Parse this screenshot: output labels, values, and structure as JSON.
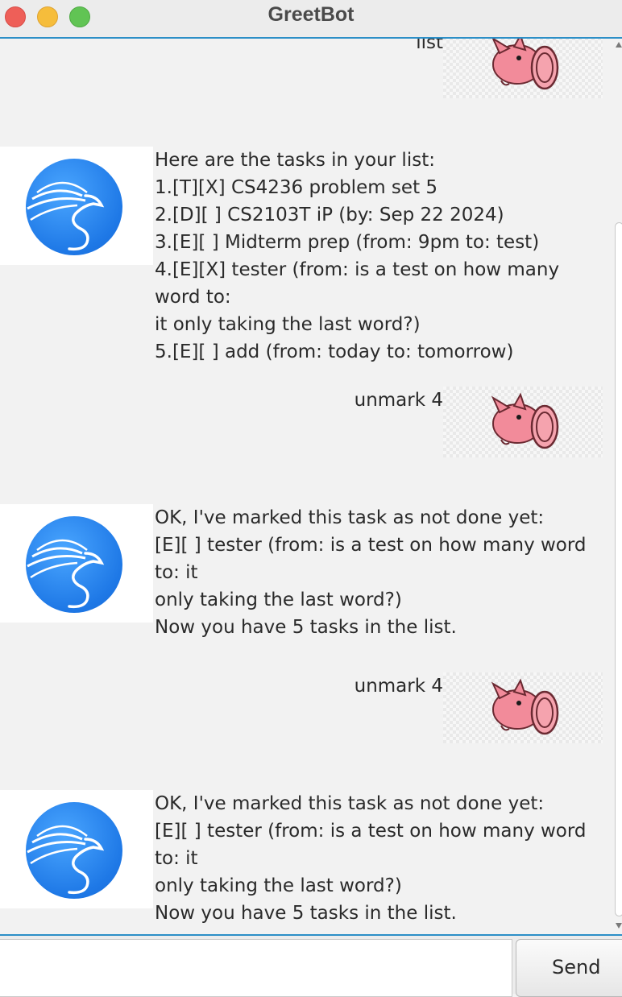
{
  "window": {
    "title": "GreetBot"
  },
  "messages": [
    {
      "sender": "user",
      "text": "list"
    },
    {
      "sender": "bot",
      "text": "Here are the tasks in your list:\n1.[T][X] CS4236 problem set 5\n2.[D][ ] CS2103T iP (by: Sep 22 2024)\n3.[E][ ] Midterm prep (from: 9pm to: test)\n4.[E][X] tester (from: is a test on how many word to:\nit only taking the last word?)\n5.[E][ ] add (from: today to: tomorrow)"
    },
    {
      "sender": "user",
      "text": "unmark 4"
    },
    {
      "sender": "bot",
      "text": "OK, I've marked this task as not done yet:\n[E][ ] tester (from: is a test on how many word to: it\nonly taking the last word?)\nNow you have 5 tasks in the list."
    },
    {
      "sender": "user",
      "text": "unmark 4"
    },
    {
      "sender": "bot",
      "text": "OK, I've marked this task as not done yet:\n[E][ ] tester (from: is a test on how many word to: it\nonly taking the last word?)\nNow you have 5 tasks in the list."
    }
  ],
  "input": {
    "value": "",
    "placeholder": ""
  },
  "send_button": {
    "label": "Send"
  },
  "icons": {
    "bot_avatar": "dragon-logo-icon",
    "user_avatar": "pig-head-icon"
  },
  "colors": {
    "accent": "#2c8fc7",
    "bot_avatar_blue": "#1e78e6",
    "pig_pink": "#f28b9a"
  }
}
